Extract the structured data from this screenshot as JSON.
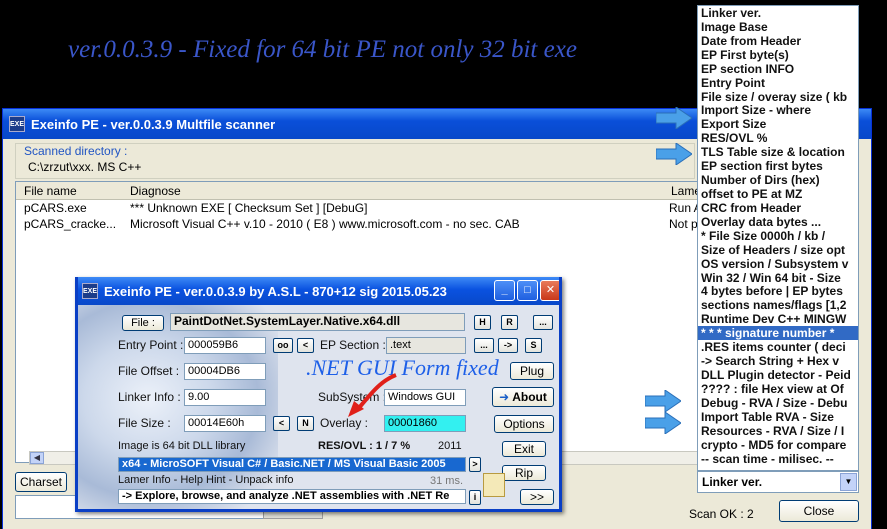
{
  "headline": "ver.0.0.3.9  - Fixed for 64 bit PE not only 32 bit exe",
  "back_window": {
    "title": "Exeinfo PE - ver.0.0.3.9  Multfile scanner",
    "scan_dir_label": "Scanned directory :",
    "scan_dir_value": "C:\\zrzut\\xxx. MS C++",
    "columns": [
      "File name",
      "Diagnose",
      "Lamer"
    ],
    "rows": [
      {
        "file": "pCARS.exe",
        "diagnose": "*** Unknown EXE  [ Checksum Set ] [DebuG]",
        "lamer": "Run A"
      },
      {
        "file": "pCARS_cracke...",
        "diagnose": "Microsoft Visual C++ v.10 - 2010 ( E8 ) www.microsoft.com - no sec. CAB",
        "lamer": "Not p"
      }
    ],
    "charset_button": "Charset",
    "close_button": "Close",
    "scan_ok": "Scan OK : 2"
  },
  "dropdown": {
    "items": [
      "Linker ver.",
      "Image Base",
      "Date from Header",
      "EP First byte(s)",
      "EP section INFO",
      "Entry Point",
      "File size / overay size ( kb",
      "Import Size - where",
      "Export Size",
      "RES/OVL %",
      "TLS Table size & location",
      "EP section first bytes",
      "Number of Dirs (hex)",
      "offset to PE at MZ",
      "CRC from Header",
      "Overlay data bytes ...",
      "* File Size   0000h / kb /",
      "Size of Headers / size opt",
      "OS version / Subsystem v",
      "Win 32 / Win 64 bit - Size",
      "4 bytes before | EP bytes",
      "sections names/flags [1,2",
      "Runtime Dev C++ MINGW",
      "*  *  * signature number *",
      ".RES items counter ( deci",
      "-> Search  String + Hex v",
      "DLL Plugin detector - Peid",
      " ???? : file Hex view at Of",
      "Debug - RVA / Size - Debu",
      "Import Table RVA - Size",
      "Resources - RVA / Size / I",
      "crypto - MD5 for compare",
      "-- scan time - milisec. --"
    ],
    "selected_index": 23,
    "combo_value": "Linker ver."
  },
  "front_window": {
    "title": "Exeinfo PE - ver.0.0.3.9  by A.S.L -  870+12 sig 2015.05.23",
    "file_button": "File :",
    "file_value": "PaintDotNet.SystemLayer.Native.x64.dll",
    "h_button": "H",
    "r_button": "R",
    "more_button": "...",
    "entry_point_label": "Entry Point :",
    "entry_point_value": "000059B6",
    "oo_button": "oo",
    "lt_button": "<",
    "ep_section_label": "EP Section :",
    "ep_section_value": ".text",
    "dots_button": "...",
    "arrow_button": "->",
    "s_button": "S",
    "file_offset_label": "File Offset :",
    "file_offset_value": "00004DB6",
    "plug_button": "Plug",
    "linker_info_label": "Linker Info :",
    "linker_info_value": "9.00",
    "subsystem_label": "SubSystem :",
    "subsystem_value": "Windows GUI",
    "about_button": "About",
    "file_size_label": "File Size :",
    "file_size_value": "00014E60h",
    "n_button": "N",
    "overlay_label": "Overlay :",
    "overlay_value": "00001860",
    "options_button": "Options",
    "image_info": "Image is 64 bit DLL library",
    "res_ovl": "RES/OVL : 1 / 7 %",
    "year": "2011",
    "exit_button": "Exit",
    "detection": "x64 - MicroSOFT Visual C# / Basic.NET / MS Visual Basic 2005",
    "lamer_info": "Lamer Info - Help Hint - Unpack info",
    "time_ms": "31 ms.",
    "rip_button": "Rip",
    "hint": "-> Explore, browse, and analyze .NET assemblies with .NET Re",
    "next_button": ">>",
    "net_annotation": ".NET GUI Form fixed"
  },
  "colors": {
    "accent": "#316ac5",
    "overlay_field": "#33f0f0",
    "title_bar": "#0a52e0",
    "arrow": "#4aa0e8"
  }
}
